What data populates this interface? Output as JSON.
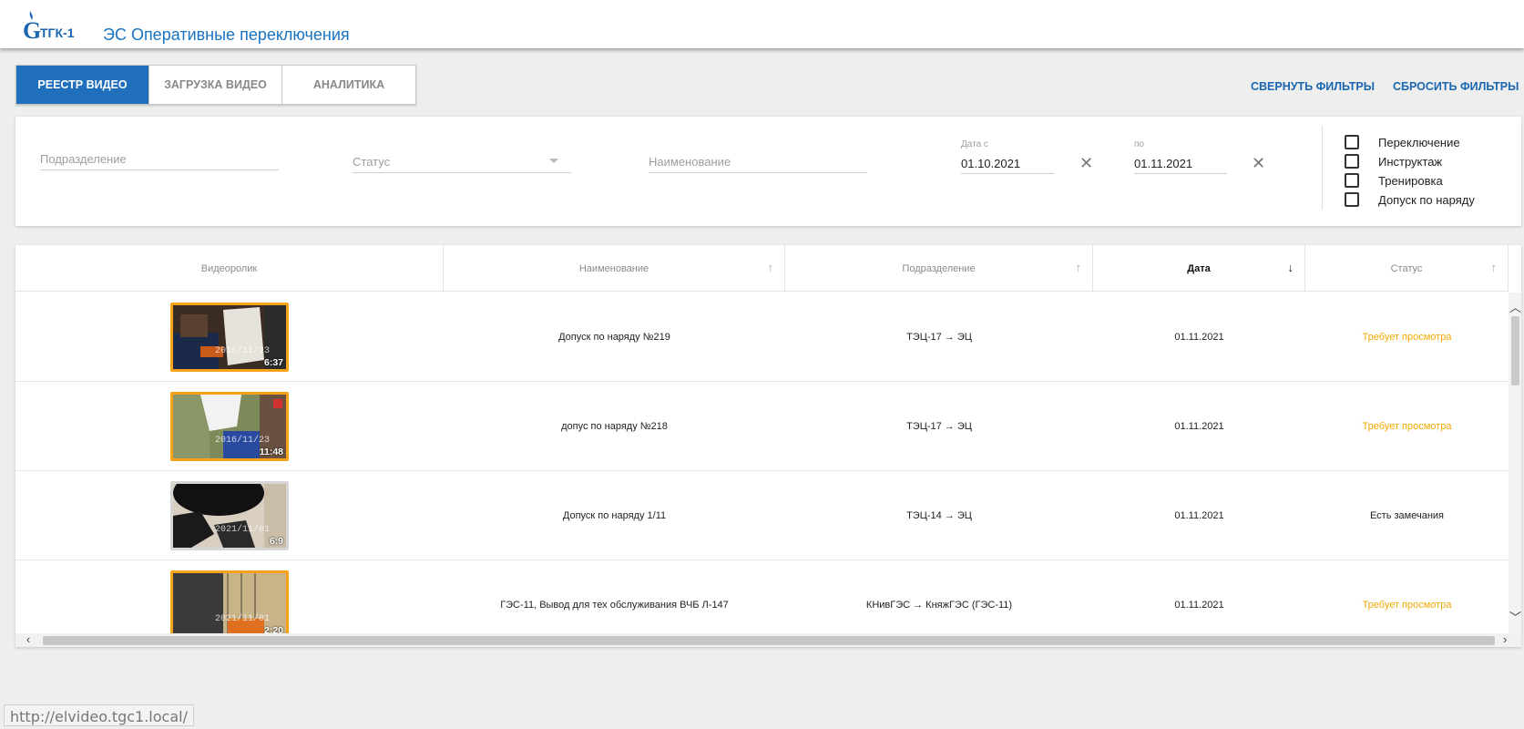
{
  "header": {
    "logo_text": "ТГК-1",
    "app_title": "ЭС Оперативные переключения"
  },
  "tabs": [
    {
      "label": "РЕЕСТР ВИДЕО",
      "active": true
    },
    {
      "label": "ЗАГРУЗКА ВИДЕО",
      "active": false
    },
    {
      "label": "АНАЛИТИКА",
      "active": false
    }
  ],
  "actions": {
    "collapse_filters": "СВЕРНУТЬ ФИЛЬТРЫ",
    "reset_filters": "СБРОСИТЬ ФИЛЬТРЫ"
  },
  "filters": {
    "subdivision_placeholder": "Подразделение",
    "status_placeholder": "Статус",
    "name_placeholder": "Наименование",
    "date_from_label": "Дата с",
    "date_from_value": "01.10.2021",
    "date_to_label": "по",
    "date_to_value": "01.11.2021",
    "types": [
      {
        "label": "Переключение",
        "checked": false
      },
      {
        "label": "Инструктаж",
        "checked": false
      },
      {
        "label": "Тренировка",
        "checked": false
      },
      {
        "label": "Допуск по наряду",
        "checked": false
      }
    ]
  },
  "table": {
    "columns": [
      "Видеоролик",
      "Наименование",
      "Подразделение",
      "Дата",
      "Статус"
    ],
    "sorted_column": "Дата",
    "rows": [
      {
        "name": "Допуск по наряду №219",
        "subdivision": "ТЭЦ-17 → ЭЦ",
        "date": "01.11.2021",
        "status": "Требует просмотра",
        "status_type": "warn",
        "thumb_ts": "2016/11/23",
        "duration": "6:37",
        "highlight": true
      },
      {
        "name": "допус по наряду №218",
        "subdivision": "ТЭЦ-17 → ЭЦ",
        "date": "01.11.2021",
        "status": "Требует просмотра",
        "status_type": "warn",
        "thumb_ts": "2016/11/23",
        "duration": "11:48",
        "highlight": true
      },
      {
        "name": "Допуск по наряду 1/11",
        "subdivision": "ТЭЦ-14 → ЭЦ",
        "date": "01.11.2021",
        "status": "Есть замечания",
        "status_type": "normal",
        "thumb_ts": "2021/11/01",
        "duration": "6:9",
        "highlight": false
      },
      {
        "name": "ГЭС-11, Вывод для тех обслуживания ВЧБ Л-147",
        "subdivision": "КНивГЭС → КняжГЭС (ГЭС-11)",
        "date": "01.11.2021",
        "status": "Требует просмотра",
        "status_type": "warn",
        "thumb_ts": "2021/11/01",
        "duration": "2:20",
        "highlight": true
      }
    ]
  },
  "colors": {
    "brand_blue": "#1f6fbd",
    "warn": "#f5a800",
    "thumb_border": "#f7a21b"
  },
  "statusbar": {
    "url": "http://elvideo.tgc1.local/"
  }
}
